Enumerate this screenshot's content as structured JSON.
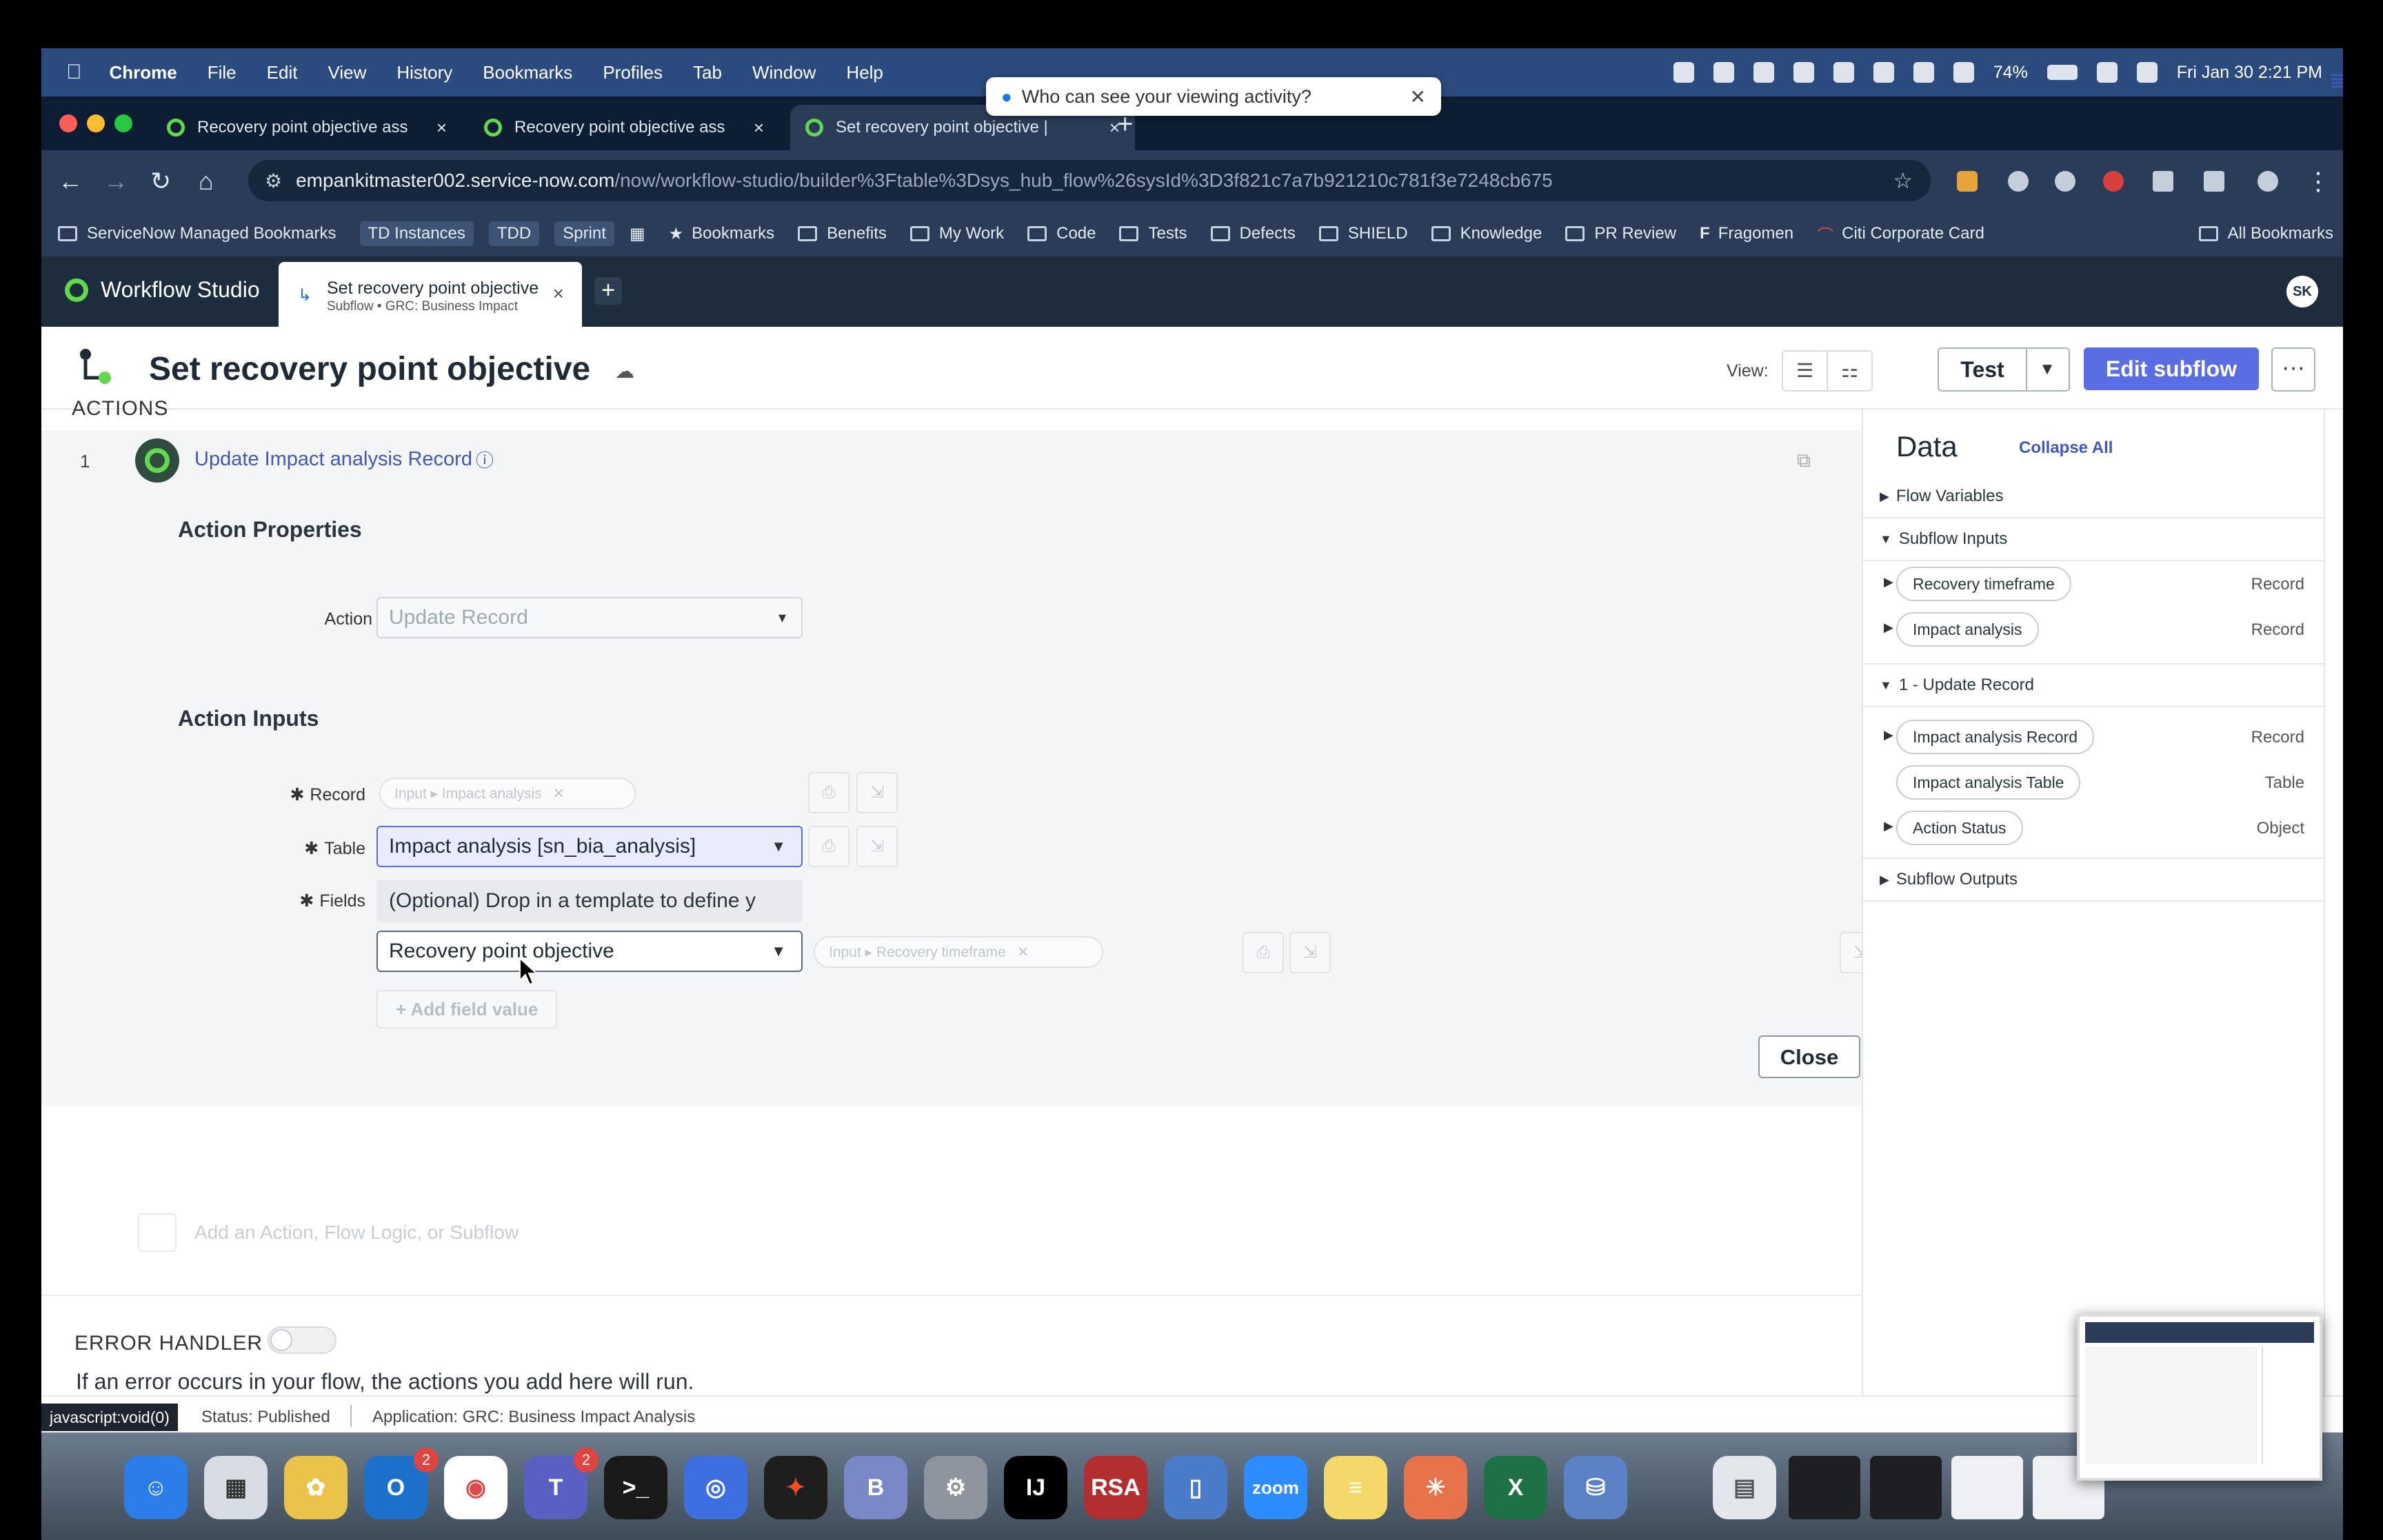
{
  "menubar": {
    "app": "Chrome",
    "items": [
      "File",
      "Edit",
      "View",
      "History",
      "Bookmarks",
      "Profiles",
      "Tab",
      "Window",
      "Help"
    ],
    "battery": "74%",
    "datetime": "Fri Jan 30  2:21 PM"
  },
  "privacy_popup": {
    "text": "Who can see your viewing activity?"
  },
  "chrome_tabs": [
    {
      "title": "Recovery point objective ass"
    },
    {
      "title": "Recovery point objective ass"
    },
    {
      "title": "Set recovery point objective |"
    }
  ],
  "address": {
    "host": "empankitmaster002.service-now.com",
    "path": "/now/workflow-studio/builder%3Ftable%3Dsys_hub_flow%26sysId%3D3f821c7a7b921210c781f3e7248cb675"
  },
  "bookmarks": {
    "items": [
      "ServiceNow Managed Bookmarks",
      "TD Instances",
      "TDD",
      "Sprint",
      "Bookmarks",
      "Benefits",
      "My Work",
      "Code",
      "Tests",
      "Defects",
      "SHIELD",
      "Knowledge",
      "PR Review",
      "Fragomen",
      "Citi Corporate Card"
    ],
    "all": "All Bookmarks"
  },
  "sn_header": {
    "app_title": "Workflow Studio",
    "tab_title": "Set recovery point objective",
    "tab_subtitle": "Subflow • GRC: Business Impact",
    "avatar": "SK"
  },
  "page": {
    "title": "Set recovery point objective",
    "view_label": "View:",
    "test_label": "Test",
    "edit_label": "Edit subflow",
    "more_label": "···"
  },
  "actions": {
    "section_label": "ACTIONS",
    "row_number": "1",
    "action_name": "Update Impact analysis Record",
    "properties_title": "Action Properties",
    "action_label": "Action",
    "action_value": "Update Record",
    "inputs_title": "Action Inputs",
    "record_label": "Record",
    "record_pill": "Input ▸ Impact analysis",
    "table_label": "Table",
    "table_value": "Impact analysis [sn_bia_analysis]",
    "fields_label": "Fields",
    "fields_placeholder": "(Optional) Drop in a template to define y",
    "field_name": "Recovery point objective",
    "field_value_pill": "Input ▸ Recovery timeframe",
    "add_field": "+ Add field value",
    "close": "Close",
    "add_action": "Add an Action, Flow Logic, or Subflow"
  },
  "error_handler": {
    "label": "ERROR HANDLER",
    "description": "If an error occurs in your flow, the actions you add here will run."
  },
  "data_panel": {
    "title": "Data",
    "collapse_all": "Collapse All",
    "flow_variables": "Flow Variables",
    "subflow_inputs": "Subflow Inputs",
    "inputs": [
      {
        "name": "Recovery timeframe",
        "type": "Record"
      },
      {
        "name": "Impact analysis",
        "type": "Record"
      }
    ],
    "update_record_section": "1 - Update Record",
    "update_record_items": [
      {
        "name": "Impact analysis Record",
        "type": "Record"
      },
      {
        "name": "Impact analysis Table",
        "type": "Table"
      },
      {
        "name": "Action Status",
        "type": "Object"
      }
    ],
    "subflow_outputs": "Subflow Outputs"
  },
  "status_bar": {
    "js_tooltip": "javascript:void(0)",
    "status": "Status: Published",
    "application": "Application: GRC: Business Impact Analysis"
  },
  "dock": {
    "outlook_badge": "2",
    "teams_badge": "2",
    "zoom_label": "zoom"
  }
}
